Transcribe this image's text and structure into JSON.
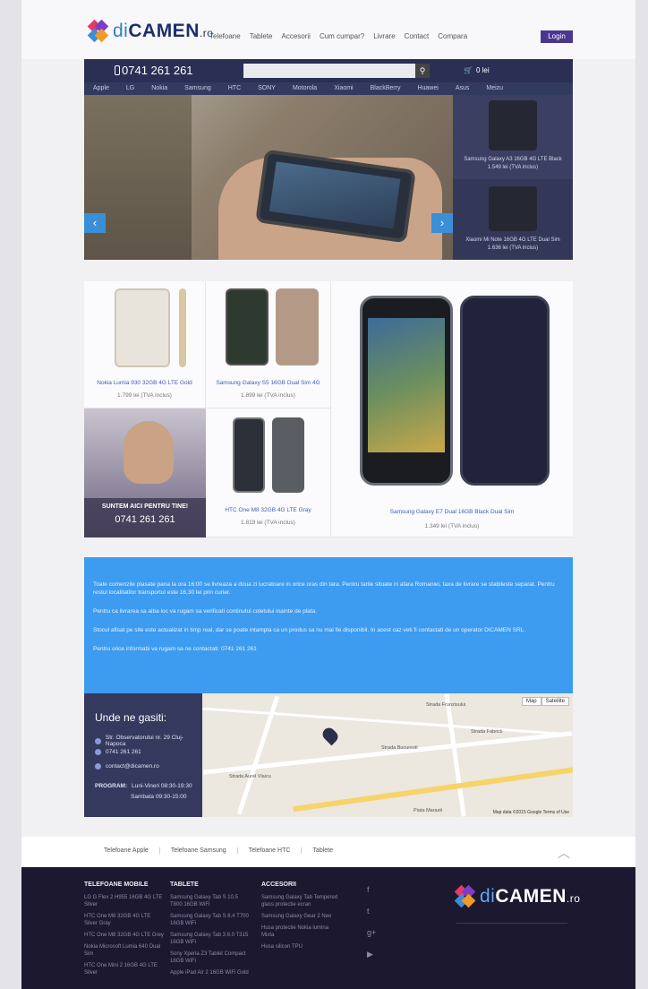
{
  "header": {
    "logo": {
      "prefix": "di",
      "name": "CAMEN",
      "suffix": ".ro"
    },
    "nav": [
      "Telefoane",
      "Tablete",
      "Accesorii",
      "Cum cumpar?",
      "Livrare",
      "Contact",
      "Compara"
    ],
    "login_label": "Login",
    "phone": "0741 261 261",
    "search_placeholder": "",
    "cart_label": "0 lei",
    "brands": [
      "Apple",
      "LG",
      "Nokia",
      "Samsung",
      "HTC",
      "SONY",
      "Motorola",
      "Xiaomi",
      "BlackBerry",
      "Huawei",
      "Asus",
      "Meizu"
    ]
  },
  "slider": {
    "side_items": [
      {
        "caption": "Samsung Galaxy A3 16GB 4G LTE Black",
        "price": "1.549 lei (TVA inclus)"
      },
      {
        "caption": "Xiaomi Mi Note 16GB 4G LTE Dual Sim",
        "price": "1.636 lei (TVA inclus)"
      }
    ]
  },
  "products": [
    {
      "name": "Nokia Lumia 930 32GB 4G LTE Gold",
      "price": "1.799 lei (TVA inclus)"
    },
    {
      "name": "Samsung Galaxy S5 16GB Dual Sim 4G",
      "price": "1.899 lei (TVA inclus)"
    },
    {
      "name": "HTC One M8 32GB 4G LTE Gray",
      "price": "1.819 lei (TVA inclus)"
    },
    {
      "name": "Samsung Galaxy E7 Dual 16GB Black Dual Sim",
      "price": "1.349 lei (TVA inclus)"
    }
  ],
  "promo": {
    "title": "SUNTEM AICI PENTRU TINE!",
    "phone": "0741 261 261"
  },
  "info": {
    "p1": "Toate comenzile plasate pana la ora 16:00 se livreaza a doua zi lucratoare in orice oras din tara. Pentru tarile situate in afara Romaniei, taxa de livrare se stabileste separat. Pentru restul localitatilor transportul este 16,30 lei prin curier.",
    "p2": "Pentru ca livrarea sa aiba loc va rugam sa verificati continutul coletului inainte de plata.",
    "p3": "Stocul afisat pe site este actualizat in timp real, dar se poate intampla ca un produs sa nu mai fie disponibil. In acest caz veti fi contactati de un operator DiCAMEN SRL.",
    "p4": "Pentru orice informatii va rugam sa ne contactati: 0741 261 261"
  },
  "contact": {
    "title": "Unde ne gasiti:",
    "address": "Str. Observatorului nr. 29 Cluj-Napoca",
    "phone": "0741 261 261",
    "email": "contact@dicamen.ro",
    "program_label": "PROGRAM:",
    "weekdays": "Luni-Vineri 08:30-19:30",
    "saturday": "Sambata   09:30-15:00"
  },
  "map": {
    "btn_map": "Map",
    "btn_satellite": "Satellite",
    "labels": [
      "Strada Bucuresti",
      "Piata Marasti",
      "Strada Fabricii",
      "Strada Aurel Vlaicu",
      "Strada Frunzisului"
    ],
    "footer": "Map data ©2015 Google  Terms of Use"
  },
  "footer_links": [
    "Telefoane Apple",
    "Telefoane Samsung",
    "Telefoane HTC",
    "Tablete"
  ],
  "footer": {
    "col1": {
      "title": "TELEFOANE MOBILE",
      "items": [
        "LG G Flex 2 H955 16GB 4G LTE Silver",
        "HTC One M8 32GB 4G LTE Silver Gray",
        "HTC One M8 32GB 4G LTE Grey",
        "Nokia Microsoft Lumia 640 Dual Sim",
        "HTC One Mini 2 16GB 4G LTE Silver"
      ]
    },
    "col2": {
      "title": "TABLETE",
      "items": [
        "Samsung Galaxy Tab S 10.5 T800 16GB WiFi",
        "Samsung Galaxy Tab S 8.4 T700 16GB WiFi",
        "Samsung Galaxy Tab 3 8.0 T315 16GB WiFi",
        "Sony Xperia Z3 Tablet Compact 16GB WiFi",
        "Apple iPad Air 2 16GB WiFi Gold"
      ]
    },
    "col3": {
      "title": "ACCESORII",
      "items": [
        "Samsung Galaxy Tab Tempered glass protectie ecran",
        "Samsung Galaxy Gear 2 Neo",
        "Husa protectie Nokia lumina Mixta",
        "Husa silicon TPU"
      ]
    },
    "social_icons": [
      "facebook-icon",
      "twitter-icon",
      "googleplus-icon",
      "youtube-icon"
    ]
  },
  "colors": {
    "brand": "#1c2e6a",
    "accent": "#3d9bf0",
    "dark": "#1c1830"
  }
}
